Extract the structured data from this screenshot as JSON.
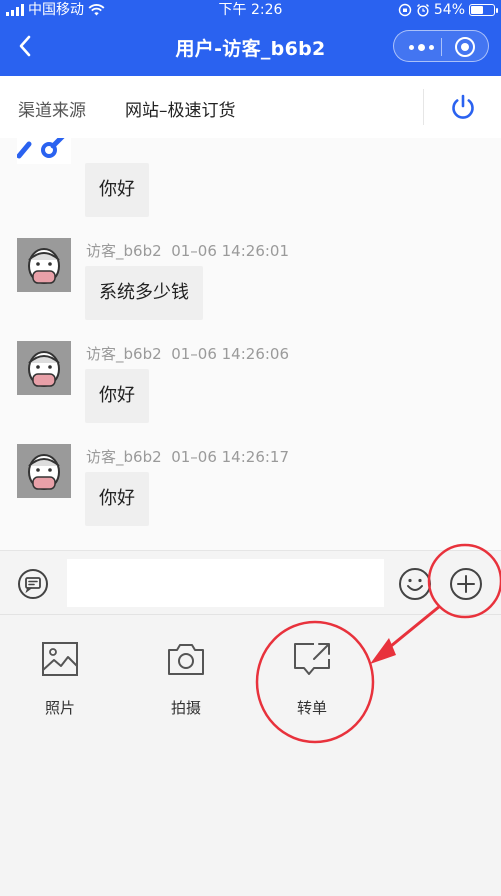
{
  "status_bar": {
    "carrier": "中国移动",
    "time": "下午 2:26",
    "battery": "54%",
    "battery_level": 0.54
  },
  "header": {
    "title": "用户-访客_b6b2",
    "back_icon": "chevron-left-icon",
    "more_icon": "more-dots-icon",
    "close_icon": "target-circle-icon",
    "background_color": "#2a62f0"
  },
  "source": {
    "label": "渠道来源",
    "value": "网站–极速订货",
    "power_icon": "power-icon",
    "accent_color": "#2a62f0"
  },
  "messages": [
    {
      "sender": "",
      "time": "",
      "text": "你好",
      "partial": true
    },
    {
      "sender": "访客_b6b2",
      "time": "01–06 14:26:01",
      "text": "系统多少钱"
    },
    {
      "sender": "访客_b6b2",
      "time": "01–06 14:26:06",
      "text": "你好"
    },
    {
      "sender": "访客_b6b2",
      "time": "01–06 14:26:17",
      "text": "你好"
    }
  ],
  "input_bar": {
    "value": "",
    "placeholder": "",
    "left_icon": "quick-reply-icon",
    "emoji_icon": "emoji-icon",
    "plus_icon": "plus-circle-icon"
  },
  "tools": [
    {
      "label": "照片",
      "icon": "image-icon"
    },
    {
      "label": "拍摄",
      "icon": "camera-icon"
    },
    {
      "label": "转单",
      "icon": "transfer-icon"
    }
  ],
  "annotation_color": "#e8323c"
}
